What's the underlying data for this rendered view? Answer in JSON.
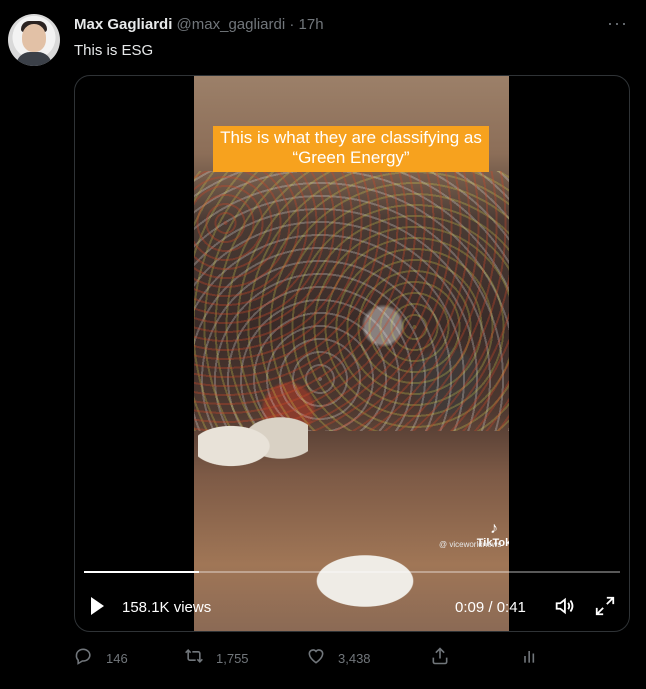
{
  "tweet": {
    "author_name": "Max Gagliardi",
    "author_handle": "@max_gagliardi",
    "separator": "·",
    "time": "17h",
    "more_label": "···",
    "text": "This is ESG"
  },
  "media": {
    "caption": "This is what they are classifying as “Green Energy”",
    "watermark_brand": "TikTok",
    "watermark_handle": "@ viceworldnews",
    "views": "158.1K views",
    "timecode": "0:09 / 0:41",
    "progress": 0.215
  },
  "actions": {
    "replies": "146",
    "retweets": "1,755",
    "likes": "3,438"
  }
}
